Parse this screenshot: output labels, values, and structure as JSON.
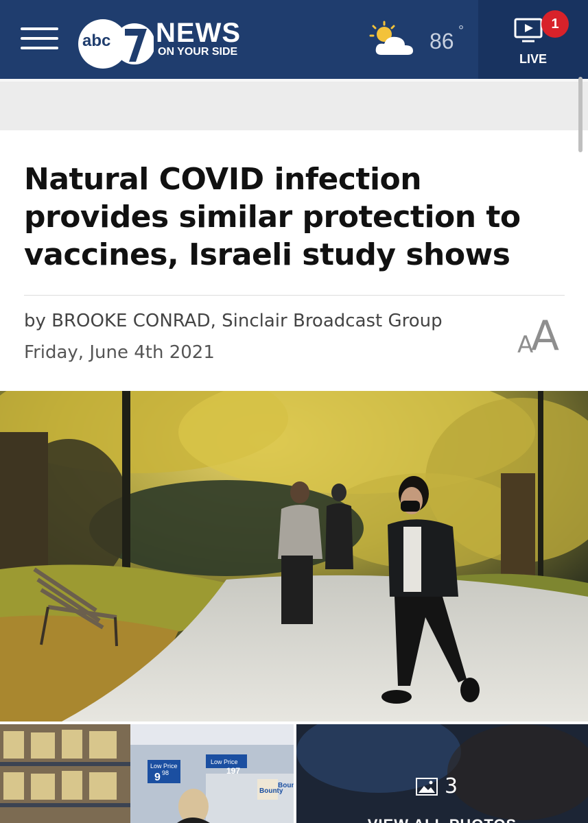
{
  "header": {
    "logo_abc": "abc",
    "logo_news": "NEWS",
    "logo_tagline": "ON YOUR SIDE",
    "weather": {
      "temperature": "86",
      "degree": "°",
      "icon": "partly-sunny-icon"
    },
    "live": {
      "label": "LIVE",
      "badge_count": "1",
      "icon": "tv-play-icon"
    },
    "menu_icon": "hamburger-menu-icon"
  },
  "article": {
    "title": "Natural COVID infection provides similar protection to vaccines, Israeli study shows",
    "byline": "by BROOKE CONRAD, Sinclair Broadcast Group",
    "date": "Friday, June 4th 2021",
    "text_size_small": "A",
    "text_size_large": "A"
  },
  "gallery": {
    "photo_count": "3",
    "view_all_label": "VIEW ALL PHOTOS",
    "price_tag_1_label": "Low Price",
    "price_tag_1_value": "9",
    "price_tag_1_cents": "98",
    "price_tag_2_label": "Low Price",
    "price_tag_2_value": "197",
    "brand_1": "Bounty",
    "brand_2": "Boun"
  },
  "colors": {
    "header_bg": "#1f3d6e",
    "live_bg": "#183360",
    "badge": "#d8222a",
    "title_text": "#111111"
  }
}
